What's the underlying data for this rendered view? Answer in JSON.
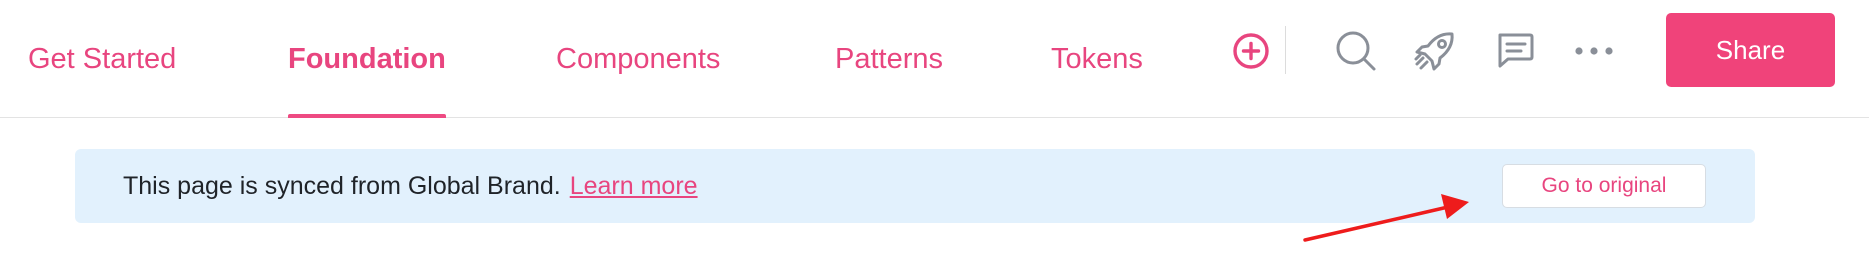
{
  "nav": {
    "tabs": [
      {
        "label": "Get Started",
        "active": false
      },
      {
        "label": "Foundation",
        "active": true
      },
      {
        "label": "Components",
        "active": false
      },
      {
        "label": "Patterns",
        "active": false
      },
      {
        "label": "Tokens",
        "active": false
      }
    ],
    "icons": [
      "add-circle-icon",
      "search-icon",
      "rocket-icon",
      "comment-icon",
      "more-icon"
    ],
    "share_label": "Share"
  },
  "banner": {
    "message": "This page is synced from Global Brand.",
    "link_label": "Learn more",
    "button_label": "Go to original"
  },
  "colors": {
    "accent": "#f0437a",
    "link": "#e8457f",
    "banner_bg": "#e2f1fd",
    "annotation_arrow": "#ee1c1c",
    "icon_gray": "#8a8f98"
  }
}
